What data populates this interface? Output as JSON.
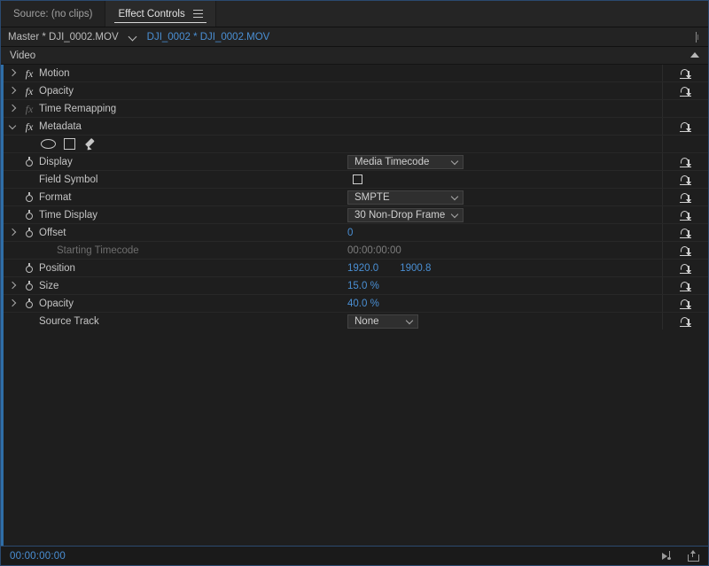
{
  "tabs": [
    {
      "label": "Source: (no clips)",
      "active": false,
      "menu": false
    },
    {
      "label": "Effect Controls",
      "active": true,
      "menu": true
    }
  ],
  "breadcrumb": {
    "master": "Master * DJI_0002.MOV",
    "caret_icon": "chevron-down-icon",
    "clip": "DJI_0002 * DJI_0002.MOV"
  },
  "section_header": {
    "label": "Video",
    "collapse_icon": "triangle-up-icon"
  },
  "effects": [
    {
      "name": "Motion",
      "state": "closed",
      "fx": "fx",
      "enabled": true,
      "reset": true
    },
    {
      "name": "Opacity",
      "state": "closed",
      "fx": "fx",
      "enabled": true,
      "reset": true
    },
    {
      "name": "Time Remapping",
      "state": "closed",
      "fx": "fx",
      "enabled": false,
      "reset": false
    },
    {
      "name": "Metadata",
      "state": "open",
      "fx": "fx",
      "enabled": true,
      "reset": true
    }
  ],
  "tools": [
    {
      "name": "ellipse-tool",
      "label": "Ellipse"
    },
    {
      "name": "rectangle-tool",
      "label": "Rectangle"
    },
    {
      "name": "pen-tool",
      "label": "Pen"
    }
  ],
  "properties": [
    {
      "label": "Display",
      "stopwatch": true,
      "triangle": "none",
      "control": "dropdown",
      "value": "Media Timecode",
      "width": "wide",
      "dim": false,
      "reset": true
    },
    {
      "label": "Field Symbol",
      "stopwatch": false,
      "triangle": "none",
      "control": "checkbox",
      "value": "",
      "checked": false,
      "dim": false,
      "reset": true
    },
    {
      "label": "Format",
      "stopwatch": true,
      "triangle": "none",
      "control": "dropdown",
      "value": "SMPTE",
      "width": "wide",
      "dim": false,
      "reset": true
    },
    {
      "label": "Time Display",
      "stopwatch": true,
      "triangle": "none",
      "control": "dropdown",
      "value": "30 Non-Drop Frame",
      "width": "wide",
      "dim": false,
      "reset": true
    },
    {
      "label": "Offset",
      "stopwatch": true,
      "triangle": "closed",
      "control": "number",
      "value": "0",
      "dim": false,
      "reset": true
    },
    {
      "label": "Starting Timecode",
      "stopwatch": false,
      "triangle": "none",
      "control": "text-dim",
      "value": "00:00:00:00",
      "dim": true,
      "reset": true
    },
    {
      "label": "Position",
      "stopwatch": true,
      "triangle": "none",
      "control": "number-pair",
      "value": "1920.0",
      "value2": "1900.8",
      "dim": false,
      "reset": true
    },
    {
      "label": "Size",
      "stopwatch": true,
      "triangle": "closed",
      "control": "number",
      "value": "15.0 %",
      "dim": false,
      "reset": true
    },
    {
      "label": "Opacity",
      "stopwatch": true,
      "triangle": "closed",
      "control": "number",
      "value": "40.0 %",
      "dim": false,
      "reset": true
    },
    {
      "label": "Source Track",
      "stopwatch": false,
      "triangle": "none",
      "control": "dropdown",
      "value": "None",
      "width": "narrow",
      "dim": false,
      "reset": true
    }
  ],
  "statusbar": {
    "timecode": "00:00:00:00",
    "icons": [
      {
        "name": "play-audio-icon"
      },
      {
        "name": "export-frame-icon"
      }
    ]
  },
  "colors": {
    "panel_bg": "#1e1e1e",
    "header_bg": "#232323",
    "accent_blue": "#4a8fd4",
    "selection_border": "#2b4a6f",
    "text": "#c4c4c4",
    "text_dim": "#6e6e6e"
  }
}
